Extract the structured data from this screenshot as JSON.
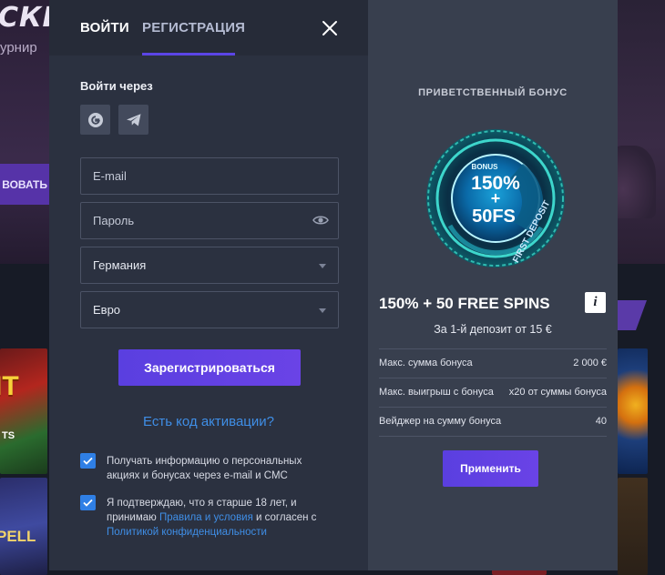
{
  "background": {
    "hero_title": "СКИ",
    "hero_subtitle": "урнир",
    "hero_button": "ВОВАТЬ",
    "tile_a_title": "IT",
    "tile_a_sub": "TS",
    "tile_b_title": "PELL"
  },
  "modal": {
    "tabs": {
      "login": "ВОЙТИ",
      "register": "РЕГИСТРАЦИЯ"
    },
    "login_via": "Войти через",
    "social": [
      {
        "icon": "google-icon"
      },
      {
        "icon": "telegram-icon"
      }
    ],
    "form": {
      "email_placeholder": "E-mail",
      "password_placeholder": "Пароль",
      "country": "Германия",
      "currency": "Евро"
    },
    "register_button": "Зарегистрироваться",
    "promo_link": "Есть код активации?",
    "checkbox_info": "Получать информацию о персональных акциях и бонусах через e-mail и СМС",
    "checkbox_age": {
      "part1": "Я подтверждаю, что я старше 18 лет, и принимаю ",
      "terms_link": "Правила и условия",
      "part2": " и согласен с ",
      "privacy_link": "Политикой конфиденциальности"
    }
  },
  "bonus": {
    "heading": "ПРИВЕТСТВЕННЫЙ БОНУС",
    "badge": {
      "top": "BONUS",
      "percent": "150%",
      "plus": "+",
      "fs": "50FS",
      "ribbon": "FIRST DEPOSIT"
    },
    "title": "150% + 50 FREE SPINS",
    "info_label": "i",
    "subtitle": "За 1-й депозит от 15 €",
    "rows": [
      {
        "label": "Макс. сумма бонуса",
        "value": "2 000 €"
      },
      {
        "label": "Макс. выигрыш с бонуса",
        "value": "x20 от суммы бонуса"
      },
      {
        "label": "Вейджер на сумму бонуса",
        "value": "40"
      }
    ],
    "apply_button": "Применить"
  },
  "colors": {
    "accent": "#5b45e6",
    "link": "#3f8ee6",
    "checkbox": "#2f7fe5",
    "panel_left": "#2b3140",
    "panel_right": "#383f4e"
  }
}
